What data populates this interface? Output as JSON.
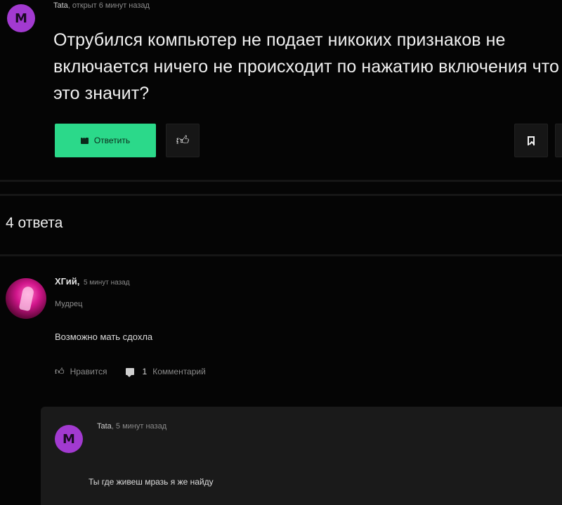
{
  "question": {
    "avatar_letter": "M",
    "author": "Tata",
    "meta": ", открыт 6 минут назад",
    "text": "Отрубился компьютер не подает никоких признаков не включается ничего не происходит по нажатию включения что это значит?",
    "reply_label": "Ответить",
    "like_icon": "thumbs-up-icon",
    "bookmark_icon": "bookmark-icon"
  },
  "answers": {
    "count_label": "4 ответа",
    "items": [
      {
        "author": "ХГий,",
        "time": "5 минут назад",
        "rank": "Мудрец",
        "text": "Возможно мать сдохла",
        "like_label": "Нравится",
        "comments_count": "1",
        "comments_label": "Комментарий",
        "comment": {
          "avatar_letter": "M",
          "author": "Tata",
          "meta": ", 5 минут назад",
          "text": "Ты где живеш мразь я же найду"
        }
      }
    ]
  },
  "colors": {
    "accent_green": "#2bd98a",
    "avatar_purple": "#a23ad0",
    "background": "#050505"
  }
}
